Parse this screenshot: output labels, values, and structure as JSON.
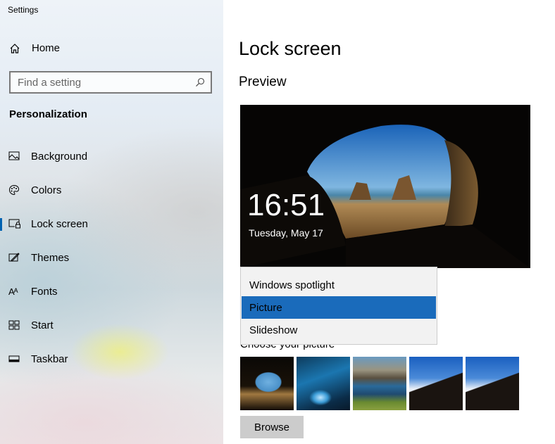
{
  "window": {
    "title": "Settings"
  },
  "sidebar": {
    "home_label": "Home",
    "search": {
      "placeholder": "Find a setting",
      "value": ""
    },
    "section": "Personalization",
    "items": [
      {
        "label": "Background",
        "icon": "picture-icon"
      },
      {
        "label": "Colors",
        "icon": "palette-icon"
      },
      {
        "label": "Lock screen",
        "icon": "lock-screen-icon",
        "selected": true
      },
      {
        "label": "Themes",
        "icon": "themes-icon"
      },
      {
        "label": "Fonts",
        "icon": "fonts-icon"
      },
      {
        "label": "Start",
        "icon": "start-icon"
      },
      {
        "label": "Taskbar",
        "icon": "taskbar-icon"
      }
    ]
  },
  "main": {
    "title": "Lock screen",
    "preview_heading": "Preview",
    "preview": {
      "time": "16:51",
      "date": "Tuesday, May 17"
    },
    "background_dropdown": {
      "options": [
        "Windows spotlight",
        "Picture",
        "Slideshow"
      ],
      "selected": "Picture"
    },
    "choose_label": "Choose your picture",
    "browse_label": "Browse"
  },
  "colors": {
    "accent": "#0063b1",
    "selected_option": "#1a6bbb"
  }
}
